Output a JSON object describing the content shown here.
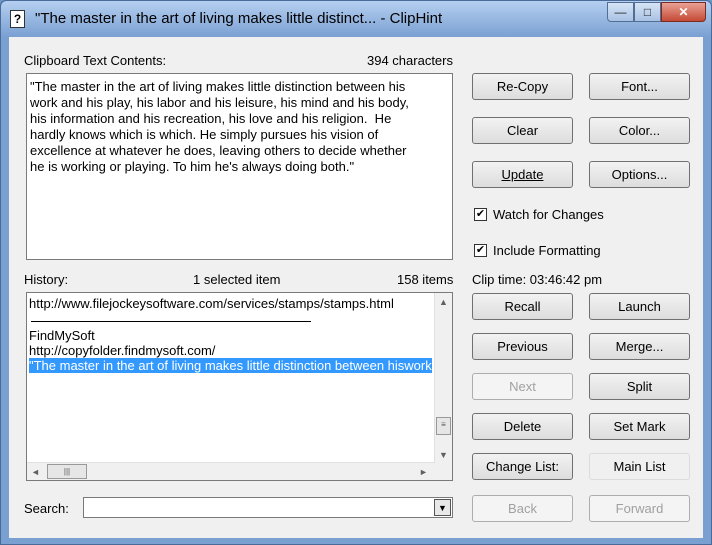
{
  "window": {
    "title": "\"The master in the art of living makes little distinct... - ClipHint",
    "minimize_glyph": "—",
    "maximize_glyph": "□",
    "close_glyph": "✕"
  },
  "clipboard": {
    "label": "Clipboard Text Contents:",
    "char_count": "394 characters",
    "text": "\"The master in the art of living makes little distinction between his\nwork and his play, his labor and his leisure, his mind and his body,\nhis information and his recreation, his love and his religion.  He\nhardly knows which is which. He simply pursues his vision of\nexcellence at whatever he does, leaving others to decide whether\nhe is working or playing. To him he's always doing both.\""
  },
  "buttons": {
    "recopy": "Re-Copy",
    "font": "Font...",
    "clear": "Clear",
    "color": "Color...",
    "update": "Update",
    "options": "Options...",
    "recall": "Recall",
    "launch": "Launch",
    "previous": "Previous",
    "merge": "Merge...",
    "next": "Next",
    "split": "Split",
    "delete": "Delete",
    "set_mark": "Set Mark",
    "change_list": "Change List:",
    "main_list": "Main List",
    "back": "Back",
    "forward": "Forward"
  },
  "checkboxes": {
    "watch": {
      "label": "Watch for Changes",
      "checked": true
    },
    "formatting": {
      "label": "Include Formatting",
      "checked": true
    },
    "check_glyph": "✔"
  },
  "clip_time": "Clip time: 03:46:42 pm",
  "history": {
    "label": "History:",
    "selected": "1 selected item",
    "count": "158 items",
    "items": [
      {
        "text": "http://www.filejockeysoftware.com/services/stamps/stamps.html",
        "selected": false
      },
      {
        "text": "FindMySoft",
        "selected": false
      },
      {
        "text": "http://copyfolder.findmysoft.com/",
        "selected": false
      },
      {
        "text": "\"The master in the art of living makes little distinction between hiswork and his play, his labor",
        "selected": true
      }
    ]
  },
  "search": {
    "label": "Search:",
    "value": ""
  },
  "icons": {
    "app": "?",
    "up": "▲",
    "down": "▼",
    "left": "◄",
    "right": "►",
    "grip_v": "≡",
    "grip_h": "|||"
  }
}
